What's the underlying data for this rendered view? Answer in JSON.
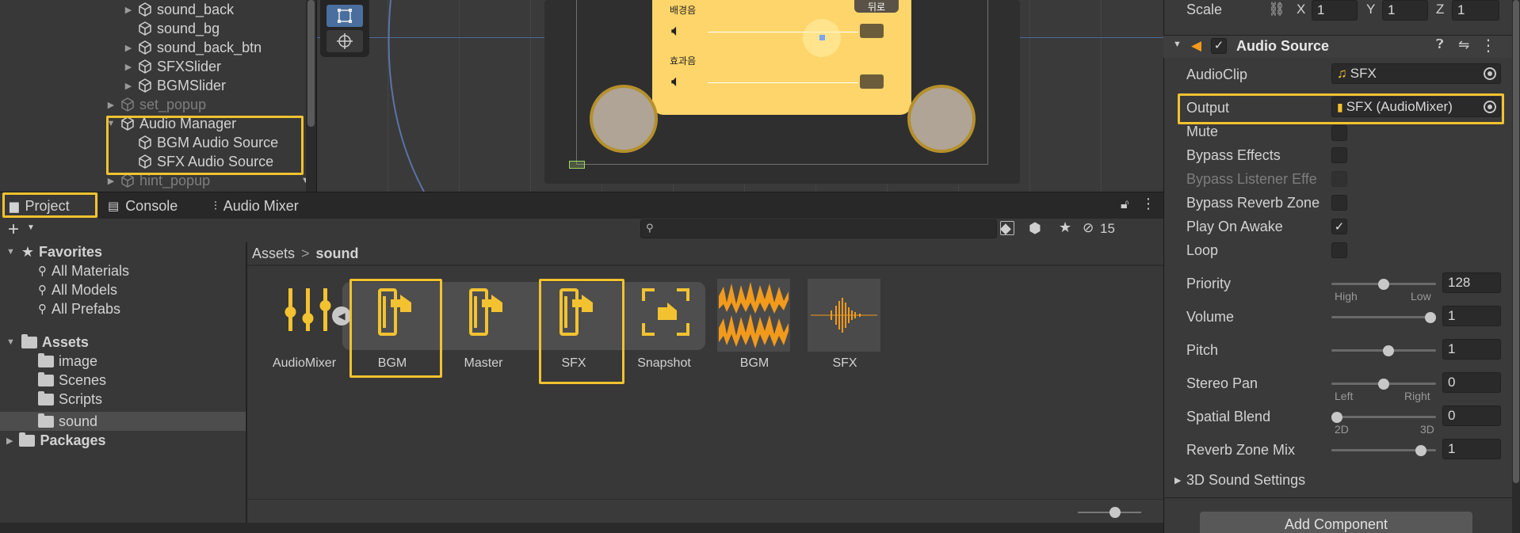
{
  "colors": {
    "highlight": "#f2c230",
    "audio_orange": "#f29a1c",
    "audio_yellow": "#f2c230",
    "panel_bg": "#383838"
  },
  "hierarchy": {
    "items": [
      {
        "label": "sound_back",
        "dim": false
      },
      {
        "label": "sound_bg",
        "dim": false
      },
      {
        "label": "sound_back_btn",
        "dim": false
      },
      {
        "label": "SFXSlider",
        "dim": false
      },
      {
        "label": "BGMSlider",
        "dim": false
      },
      {
        "label": "set_popup",
        "dim": true
      },
      {
        "label": "Audio Manager",
        "dim": false
      },
      {
        "label": "BGM Audio Source",
        "dim": false
      },
      {
        "label": "SFX Audio Source",
        "dim": false
      },
      {
        "label": "hint_popup",
        "dim": true
      }
    ]
  },
  "scene": {
    "popup_text_1": "배경음",
    "popup_text_2": "효과음",
    "popup_button": "뒤로"
  },
  "tabs": [
    {
      "label": "Project",
      "icon": "folder-icon"
    },
    {
      "label": "Console",
      "icon": "console-icon"
    },
    {
      "label": "Audio Mixer",
      "icon": "mixer-icon"
    }
  ],
  "project": {
    "hidden_count": "15",
    "add_label": "+",
    "search_placeholder": "",
    "tree": {
      "favorites": "Favorites",
      "fav_items": [
        "All Materials",
        "All Models",
        "All Prefabs"
      ],
      "assets": "Assets",
      "asset_items": [
        "image",
        "Scenes",
        "Scripts",
        "sound"
      ],
      "packages": "Packages"
    },
    "breadcrumb": {
      "root": "Assets",
      "separator": ">",
      "current": "sound"
    },
    "assets": [
      {
        "label": "AudioMixer",
        "icon": "audio-mixer-icon"
      },
      {
        "label": "BGM",
        "icon": "mixer-group-icon"
      },
      {
        "label": "Master",
        "icon": "mixer-group-icon"
      },
      {
        "label": "SFX",
        "icon": "mixer-group-icon"
      },
      {
        "label": "Snapshot",
        "icon": "snapshot-icon"
      },
      {
        "label": "BGM",
        "icon": "audio-clip-waveform-icon"
      },
      {
        "label": "SFX",
        "icon": "audio-clip-waveform-icon"
      }
    ]
  },
  "inspector": {
    "scale": {
      "label": "Scale",
      "x_label": "X",
      "x": "1",
      "y_label": "Y",
      "y": "1",
      "z_label": "Z",
      "z": "1"
    },
    "component_title": "Audio Source",
    "audio_clip": {
      "label": "AudioClip",
      "value": "SFX"
    },
    "output": {
      "label": "Output",
      "value": "SFX (AudioMixer)"
    },
    "toggles": [
      {
        "label": "Mute",
        "checked": false,
        "dim": false
      },
      {
        "label": "Bypass Effects",
        "checked": false,
        "dim": false
      },
      {
        "label": "Bypass Listener Effe",
        "checked": false,
        "dim": true
      },
      {
        "label": "Bypass Reverb Zone",
        "checked": false,
        "dim": false
      },
      {
        "label": "Play On Awake",
        "checked": true,
        "dim": false
      },
      {
        "label": "Loop",
        "checked": false,
        "dim": false
      }
    ],
    "priority": {
      "label": "Priority",
      "value": "128",
      "fraction": 0.5,
      "low_label": "High",
      "high_label": "Low"
    },
    "volume": {
      "label": "Volume",
      "value": "1",
      "fraction": 1.0
    },
    "pitch": {
      "label": "Pitch",
      "value": "1",
      "fraction": 0.55
    },
    "stereo_pan": {
      "label": "Stereo Pan",
      "value": "0",
      "fraction": 0.5,
      "low_label": "Left",
      "high_label": "Right"
    },
    "spatial_blend": {
      "label": "Spatial Blend",
      "value": "0",
      "fraction": 0.0,
      "low_label": "2D",
      "high_label": "3D"
    },
    "reverb_zone_mix": {
      "label": "Reverb Zone Mix",
      "value": "1",
      "fraction": 0.9
    },
    "sound_settings": "3D Sound Settings",
    "add_component": "Add Component"
  }
}
